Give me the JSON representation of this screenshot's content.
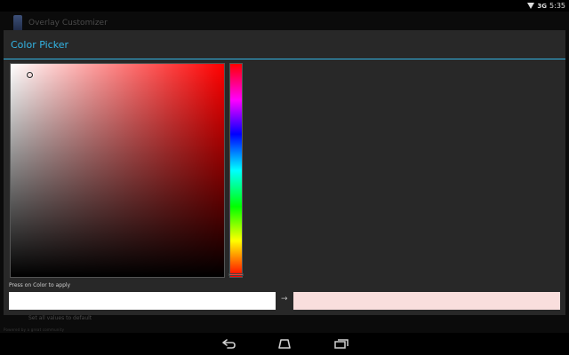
{
  "status_bar": {
    "time": "5:35",
    "signal": "3G"
  },
  "background_app": {
    "title": "Overlay Customizer",
    "footer_text": "Powered by a great community",
    "reset_text": "Set all values to default"
  },
  "dialog": {
    "title": "Color Picker",
    "apply_hint": "Press on Color to apply",
    "arrow": "→",
    "old_color": "#ffffff",
    "new_color": "#f9dedd",
    "hue_color": "#ff0000",
    "accent_color": "#33b5e5"
  },
  "nav": {
    "back": "back-icon",
    "home": "home-icon",
    "recents": "recents-icon"
  }
}
